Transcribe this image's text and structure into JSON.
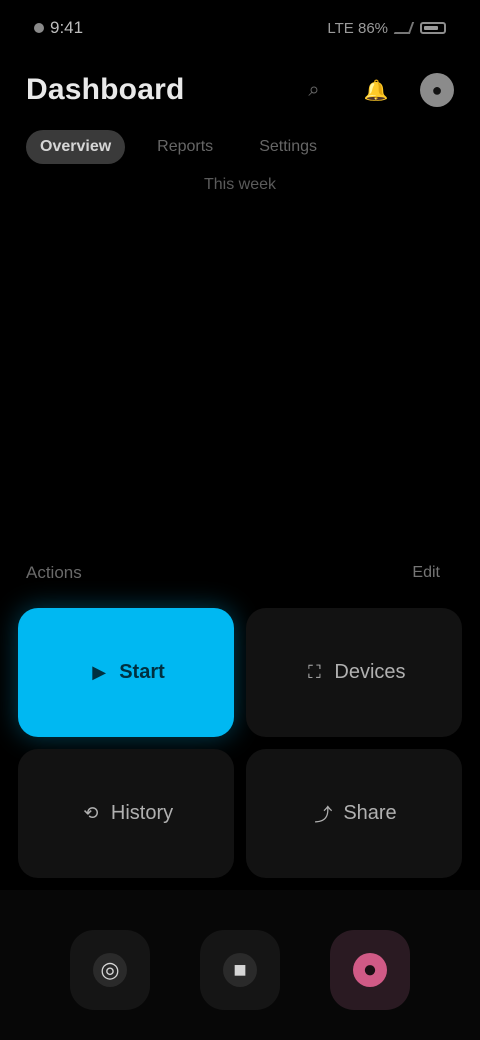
{
  "status": {
    "time": "9:41",
    "right_text": "LTE 86%"
  },
  "header": {
    "title": "Dashboard",
    "actions": [
      {
        "icon": "search-icon",
        "glyph": "⌕"
      },
      {
        "icon": "bell-icon",
        "glyph": "🔔"
      },
      {
        "icon": "profile-icon",
        "glyph": "●"
      }
    ]
  },
  "tabs": [
    {
      "label": "Overview"
    },
    {
      "label": "Reports"
    },
    {
      "label": "Settings"
    }
  ],
  "period": "This week",
  "section": {
    "title": "Actions",
    "action": "Edit"
  },
  "cards": [
    {
      "label": "Start",
      "glyph": "▶"
    },
    {
      "label": "Devices",
      "glyph": "⛶"
    },
    {
      "label": "History",
      "glyph": "⟲"
    },
    {
      "label": "Share",
      "glyph": "⤴"
    }
  ],
  "bottom": {
    "left_glyph": "◎",
    "middle_glyph": "■",
    "right_glyph": "●"
  },
  "colors": {
    "accent": "#00B8F2",
    "pink": "#D05A86",
    "bg": "#000000"
  }
}
